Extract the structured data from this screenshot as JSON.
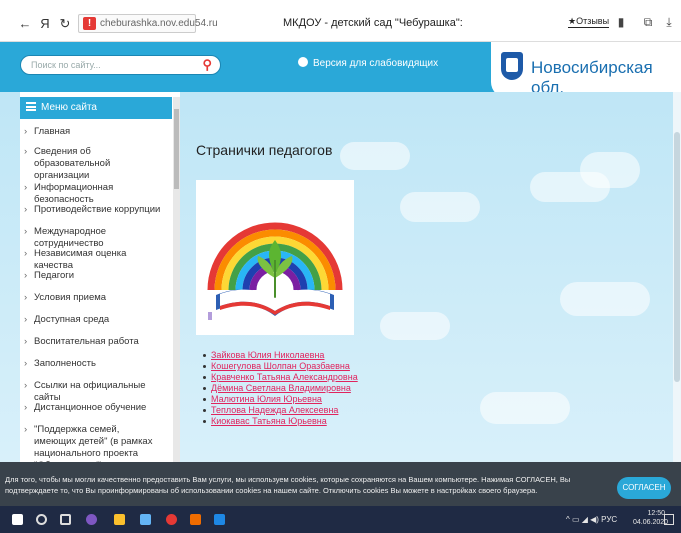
{
  "browser": {
    "back": "←",
    "yandex": "Я",
    "reload": "↻",
    "url": "cheburashka.nov.edu54.ru",
    "tab_title": "МКДОУ - детский сад \"Чебурашка\":",
    "reviews_label": "★Отзывы"
  },
  "header": {
    "search_placeholder": "Поиск по сайту...",
    "low_vision_label": "Версия для слабовидящих",
    "region_name": "Новосибирская обл."
  },
  "sidebar": {
    "menu_title": "Меню сайта",
    "items": [
      {
        "label": "Главная"
      },
      {
        "label": "Сведения об образовательной организации"
      },
      {
        "label": "Информационная безопасность"
      },
      {
        "label": "Противодействие коррупции"
      },
      {
        "label": "Международное сотрудничество"
      },
      {
        "label": "Независимая оценка качества"
      },
      {
        "label": "Педагоги"
      },
      {
        "label": "Условия приема"
      },
      {
        "label": "Доступная среда"
      },
      {
        "label": "Воспитательная работа"
      },
      {
        "label": "Заполненость"
      },
      {
        "label": "Ссылки на официальные сайты"
      },
      {
        "label": "Дистанционное обучение"
      },
      {
        "label": "\"Поддержка семей, имеющих детей\" (в рамках национального проекта \"Образование\")"
      }
    ]
  },
  "main": {
    "heading": "Странички педагогов",
    "teachers": [
      "Зайкова Юлия Николаевна",
      "Кошегулова Шолпан Оразбаевна",
      "Кравченко Татьяна Александровна",
      "Дёмина Светлана Владимировна",
      "Малютина Юлия Юрьевна",
      "Теплова Надежда Алексеевна",
      "Киокавас Татьяна Юрьевна"
    ]
  },
  "cookie": {
    "text": "Для того, чтобы мы могли качественно предоставить Вам услуги, мы используем cookies, которые сохраняются на Вашем компьютере. Нажимая СОГЛАСЕН, Вы подтверждаете то, что Вы проинформированы об использовании cookies на нашем сайте. Отключить cookies Вы можете в настройках своего браузера.",
    "agree_label": "СОГЛАСЕН"
  },
  "taskbar": {
    "lang": "РУС",
    "time": "12:50",
    "date": "04.06.2020"
  },
  "colors": {
    "accent": "#2aa8d8",
    "link": "#e0245e",
    "cookie_bg": "#39424b",
    "taskbar_bg": "#1f2a44"
  }
}
